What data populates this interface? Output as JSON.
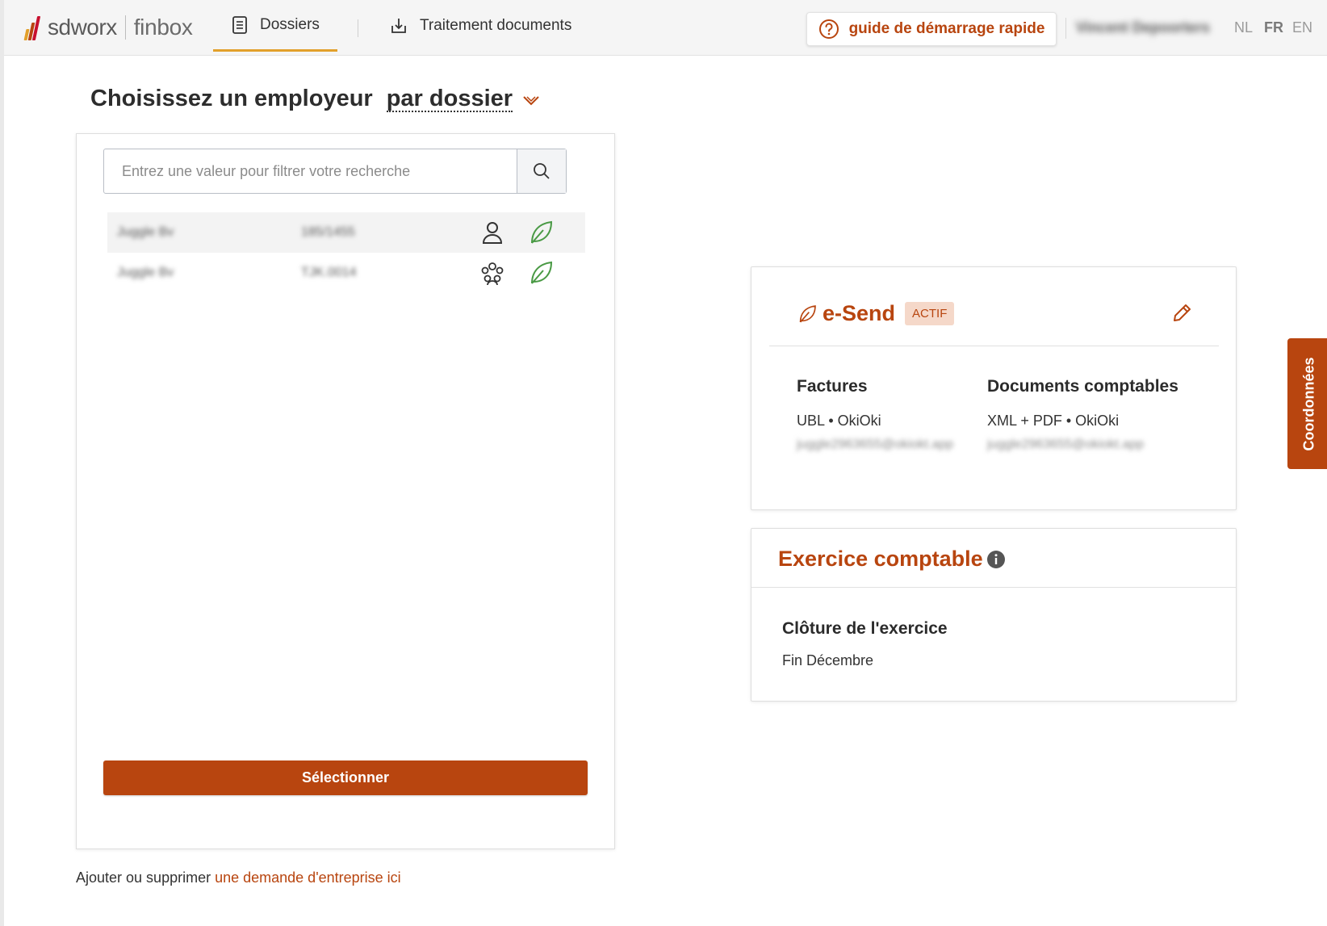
{
  "header": {
    "logo_brand": "sdworx",
    "logo_product": "finbox",
    "tabs": [
      {
        "label": "Dossiers",
        "icon": "document-list-icon",
        "active": true
      },
      {
        "label": "Traitement documents",
        "icon": "download-tray-icon",
        "active": false
      }
    ],
    "guide_label": "guide de démarrage rapide",
    "user_name": "Vincent Depoorters",
    "languages": [
      {
        "code": "NL",
        "active": false
      },
      {
        "code": "FR",
        "active": true
      },
      {
        "code": "EN",
        "active": false
      }
    ]
  },
  "colors": {
    "accent": "#b8450f",
    "tab_underline": "#e2a02b",
    "leaf_green": "#4a9a45"
  },
  "title": {
    "text": "Choisissez un employeur",
    "by_label": "par dossier"
  },
  "search": {
    "placeholder": "Entrez une valeur pour filtrer votre recherche",
    "value": ""
  },
  "employers": [
    {
      "name": "Juggle Bv",
      "code": "185/1455",
      "type_icon": "person-icon",
      "status_icon": "leaf-icon",
      "selected": true
    },
    {
      "name": "Juggle Bv",
      "code": "TJK.0014",
      "type_icon": "group-icon",
      "status_icon": "leaf-icon",
      "selected": false
    }
  ],
  "select_button": "Sélectionner",
  "footer": {
    "prefix": "Ajouter ou supprimer ",
    "link": "une demande d'entreprise ici"
  },
  "esend": {
    "title": "e-Send",
    "badge": "ACTIF",
    "columns": [
      {
        "heading": "Factures",
        "value": "UBL • OkiOki",
        "email": "juggle2963655@okiokt.app"
      },
      {
        "heading": "Documents comptables",
        "value": "XML + PDF • OkiOki",
        "email": "juggle2963655@okiokt.app"
      }
    ]
  },
  "exercice": {
    "title": "Exercice comptable",
    "label": "Clôture de l'exercice",
    "value": "Fin Décembre"
  },
  "side_tab": "Coordonnées"
}
